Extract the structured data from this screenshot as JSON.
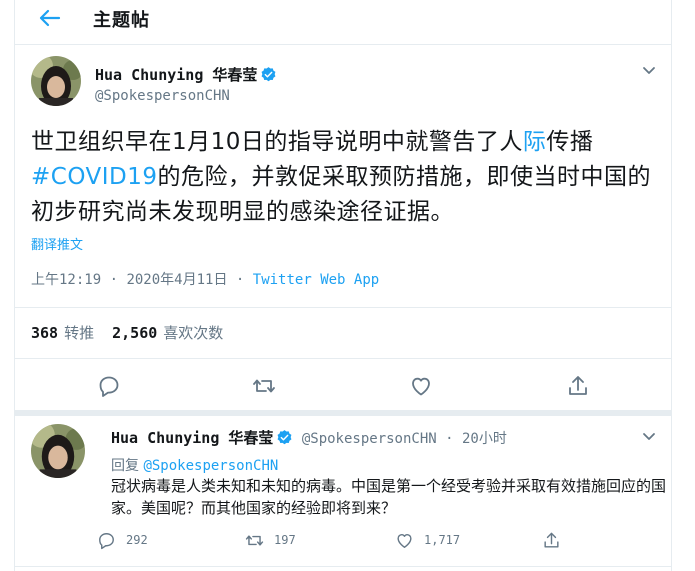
{
  "header": {
    "title": "主题帖"
  },
  "main_tweet": {
    "display_name": "Hua Chunying 华春莹",
    "handle": "@SpokespersonCHN",
    "text_part1": "世卫组织早在1月10日的指导说明中就警告了人",
    "text_link1": "际",
    "text_part2": "传播",
    "text_hashtag": "#COVID19",
    "text_part3": "的危险，并敦促采取预防措施，即使当时中国的初步研究尚未发现明显的感染途径证据。",
    "translate_label": "翻译推文",
    "time": "上午12:19",
    "date": "2020年4月11日",
    "source": "Twitter Web App",
    "retweets_count": "368",
    "retweets_label": "转推",
    "likes_count": "2,560",
    "likes_label": "喜欢次数"
  },
  "reply_tweet": {
    "display_name": "Hua Chunying 华春莹",
    "handle": "@SpokespersonCHN",
    "time": "20小时",
    "replying_label": "回复",
    "replying_handle": "@SpokespersonCHN",
    "text": "冠状病毒是人类未知和未知的病毒。中国是第一个经受考验并采取有效措施回应的国家。美国呢？而其他国家的经验即将到来？",
    "reply_count": "292",
    "retweet_count": "197",
    "like_count": "1,717"
  },
  "colors": {
    "accent": "#1da1f2",
    "secondary_text": "#657786",
    "border": "#e6ecf0",
    "verified": "#1da1f2"
  },
  "icons": [
    "back-arrow-icon",
    "verified-badge-icon",
    "chevron-down-icon",
    "reply-icon",
    "retweet-icon",
    "like-icon",
    "share-icon"
  ]
}
